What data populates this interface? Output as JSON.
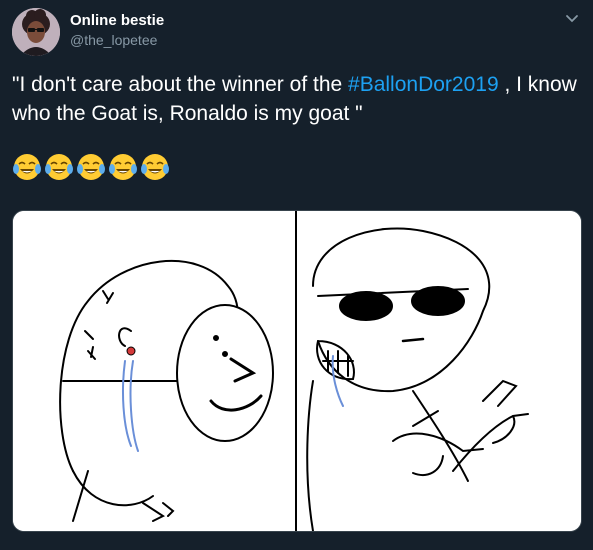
{
  "author": {
    "display_name": "Online bestie",
    "handle": "@the_lopetee",
    "avatar_icon": "profile-photo-avatar"
  },
  "menu": {
    "icon": "chevron-down-icon"
  },
  "tweet": {
    "text_before": "\"I don't care about the winner of the ",
    "hashtag": "#BallonDor2019",
    "text_after": " , I know who the Goat is, Ronaldo is my goat \"",
    "emoji_count": 5,
    "emoji_icon": "face-with-tears-of-joy-icon"
  },
  "media": {
    "description_icon": "meme-crying-wojak-with-mask-and-cool-sunglasses-pointing"
  },
  "colors": {
    "background": "#15202b",
    "hashtag": "#1da1f2",
    "secondary_text": "#8899a6"
  }
}
